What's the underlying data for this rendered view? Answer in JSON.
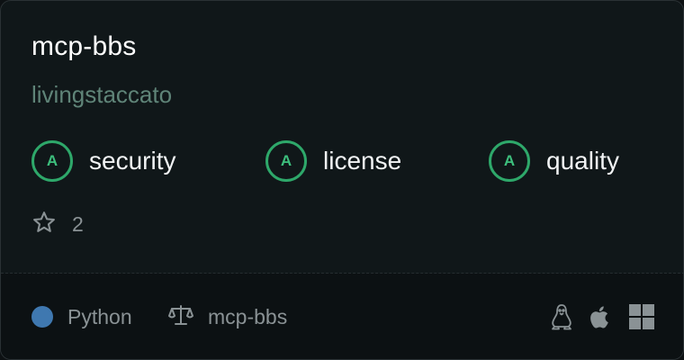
{
  "repo": {
    "name": "mcp-bbs",
    "owner": "livingstaccato"
  },
  "scores": [
    {
      "grade": "A",
      "label": "security"
    },
    {
      "grade": "A",
      "label": "license"
    },
    {
      "grade": "A",
      "label": "quality"
    }
  ],
  "stars": {
    "icon": "star-icon",
    "count": "2"
  },
  "footer": {
    "language": "Python",
    "language_color": "#3f78b0",
    "license_icon": "scale-icon",
    "license": "mcp-bbs",
    "platforms": [
      "linux-icon",
      "apple-icon",
      "windows-icon"
    ]
  },
  "colors": {
    "grade_accent": "#2ea86a",
    "owner_text": "#5f8478"
  }
}
